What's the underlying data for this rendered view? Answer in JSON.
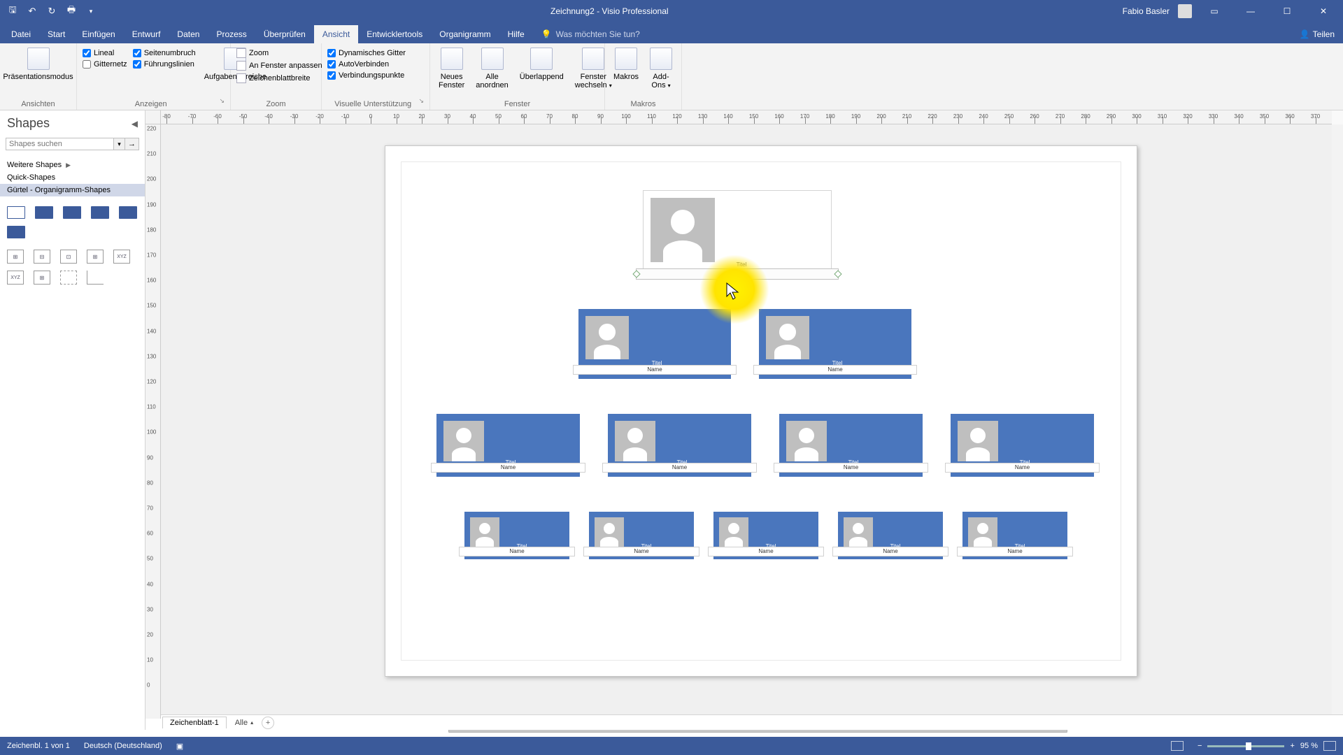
{
  "titlebar": {
    "document_title": "Zeichnung2 - Visio Professional",
    "user_name": "Fabio Basler"
  },
  "menu": {
    "tabs": [
      "Datei",
      "Start",
      "Einfügen",
      "Entwurf",
      "Daten",
      "Prozess",
      "Überprüfen",
      "Ansicht",
      "Entwicklertools",
      "Organigramm",
      "Hilfe"
    ],
    "active_index": 7,
    "tellme": "Was möchten Sie tun?",
    "share": "Teilen"
  },
  "ribbon": {
    "ansichten": {
      "label": "Ansichten",
      "presentation": "Präsentationsmodus"
    },
    "anzeigen": {
      "label": "Anzeigen",
      "lineal": "Lineal",
      "gitternetz": "Gitternetz",
      "seitenumbruch": "Seitenumbruch",
      "fuehrungslinien": "Führungslinien",
      "aufgabenbereiche": "Aufgabenbereiche"
    },
    "zoom": {
      "label": "Zoom",
      "zoom": "Zoom",
      "fit": "An Fenster anpassen",
      "width": "Zeichenblattbreite"
    },
    "visuelle": {
      "label": "Visuelle Unterstützung",
      "dyn": "Dynamisches Gitter",
      "auto": "AutoVerbinden",
      "conn": "Verbindungspunkte"
    },
    "fenster": {
      "label": "Fenster",
      "neues": "Neues\nFenster",
      "alle": "Alle\nanordnen",
      "ueber": "Überlappend",
      "wechseln": "Fenster\nwechseln"
    },
    "makros": {
      "label": "Makros",
      "makros": "Makros",
      "addons": "Add-\nOns"
    }
  },
  "shapes": {
    "title": "Shapes",
    "search_placeholder": "Shapes suchen",
    "more": "Weitere Shapes",
    "quick": "Quick-Shapes",
    "stencil": "Gürtel - Organigramm-Shapes"
  },
  "ruler_h": [
    -80,
    -70,
    -60,
    -50,
    -40,
    -30,
    -20,
    -10,
    0,
    10,
    20,
    30,
    40,
    50,
    60,
    70,
    80,
    90,
    100,
    110,
    120,
    130,
    140,
    150,
    160,
    170,
    180,
    190,
    200,
    210,
    220,
    230,
    240,
    250,
    260,
    270,
    280,
    290,
    300,
    310,
    320,
    330,
    340,
    350,
    360,
    370
  ],
  "ruler_v": [
    220,
    210,
    200,
    190,
    180,
    170,
    160,
    150,
    140,
    130,
    120,
    110,
    100,
    90,
    80,
    70,
    60,
    50,
    40,
    30,
    20,
    10,
    0
  ],
  "org": {
    "title": "Titel",
    "name": "Name"
  },
  "tabs": {
    "sheet": "Zeichenblatt-1",
    "all": "Alle"
  },
  "status": {
    "page": "Zeichenbl. 1 von 1",
    "lang": "Deutsch (Deutschland)",
    "zoom": "95 %"
  }
}
